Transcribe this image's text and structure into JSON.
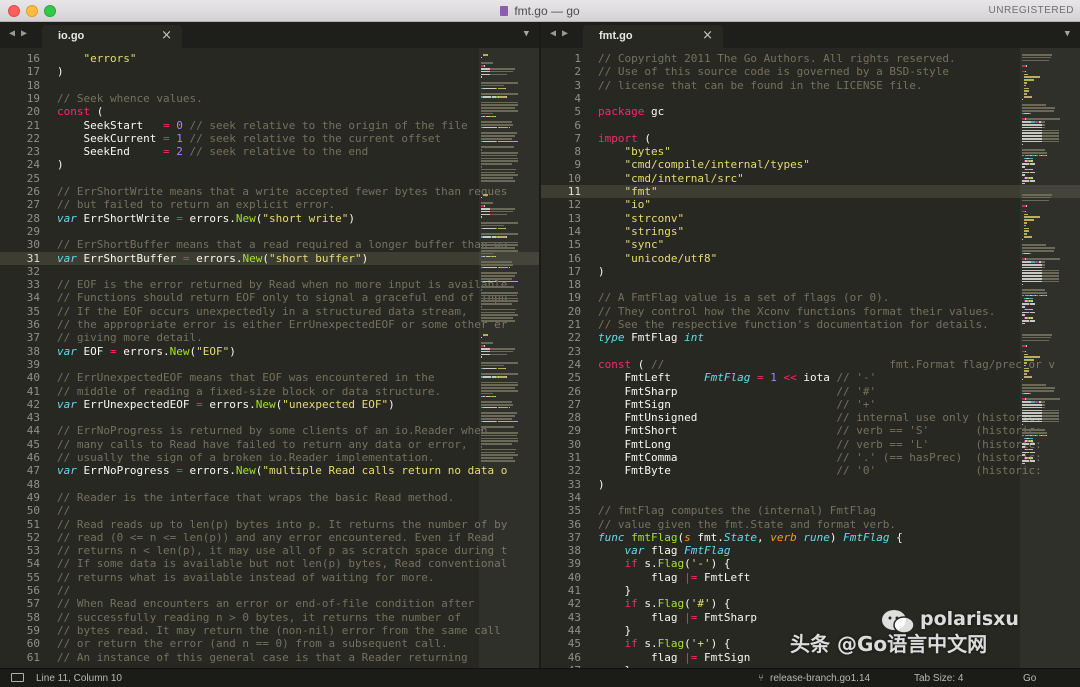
{
  "window": {
    "title": "fmt.go — go",
    "status_label": "UNREGISTERED"
  },
  "left_pane": {
    "tab_label": "io.go",
    "current_line": 31,
    "lines": [
      [
        16,
        [
          [
            "    ",
            "id"
          ],
          [
            "\"errors\"",
            "s"
          ]
        ]
      ],
      [
        17,
        [
          [
            ")",
            "id"
          ]
        ]
      ],
      [
        18,
        []
      ],
      [
        19,
        [
          [
            "// Seek whence values.",
            "c"
          ]
        ]
      ],
      [
        20,
        [
          [
            "const",
            "k"
          ],
          [
            " (",
            "id"
          ]
        ]
      ],
      [
        21,
        [
          [
            "    SeekStart   ",
            "id"
          ],
          [
            "= ",
            "k"
          ],
          [
            "0",
            "n"
          ],
          [
            " // seek relative to the origin of the file",
            "c"
          ]
        ]
      ],
      [
        22,
        [
          [
            "    SeekCurrent ",
            "id"
          ],
          [
            "= ",
            "k"
          ],
          [
            "1",
            "n"
          ],
          [
            " // seek relative to the current offset",
            "c"
          ]
        ]
      ],
      [
        23,
        [
          [
            "    SeekEnd     ",
            "id"
          ],
          [
            "= ",
            "k"
          ],
          [
            "2",
            "n"
          ],
          [
            " // seek relative to the end",
            "c"
          ]
        ]
      ],
      [
        24,
        [
          [
            ")",
            "id"
          ]
        ]
      ],
      [
        25,
        []
      ],
      [
        26,
        [
          [
            "// ErrShortWrite means that a write accepted fewer bytes than reques",
            "c"
          ]
        ]
      ],
      [
        27,
        [
          [
            "// but failed to return an explicit error.",
            "c"
          ]
        ]
      ],
      [
        28,
        [
          [
            "var",
            "kb"
          ],
          [
            " ErrShortWrite ",
            "id"
          ],
          [
            "=",
            "k"
          ],
          [
            " errors.",
            "id"
          ],
          [
            "New",
            "f"
          ],
          [
            "(",
            "id"
          ],
          [
            "\"short write\"",
            "s"
          ],
          [
            ")",
            "id"
          ]
        ]
      ],
      [
        29,
        []
      ],
      [
        30,
        [
          [
            "// ErrShortBuffer means that a read required a longer buffer than wa",
            "c"
          ]
        ]
      ],
      [
        31,
        [
          [
            "var",
            "kb"
          ],
          [
            " ErrShortBuffer ",
            "id"
          ],
          [
            "=",
            "k"
          ],
          [
            " errors.",
            "id"
          ],
          [
            "New",
            "f"
          ],
          [
            "(",
            "id"
          ],
          [
            "\"short buffer\"",
            "s"
          ],
          [
            ")",
            "id"
          ]
        ]
      ],
      [
        32,
        []
      ],
      [
        33,
        [
          [
            "// EOF is the error returned by Read when no more input is available",
            "c"
          ]
        ]
      ],
      [
        34,
        [
          [
            "// Functions should return EOF only to signal a graceful end of inpu",
            "c"
          ]
        ]
      ],
      [
        35,
        [
          [
            "// If the EOF occurs unexpectedly in a structured data stream,",
            "c"
          ]
        ]
      ],
      [
        36,
        [
          [
            "// the appropriate error is either ErrUnexpectedEOF or some other er",
            "c"
          ]
        ]
      ],
      [
        37,
        [
          [
            "// giving more detail.",
            "c"
          ]
        ]
      ],
      [
        38,
        [
          [
            "var",
            "kb"
          ],
          [
            " EOF ",
            "id"
          ],
          [
            "=",
            "k"
          ],
          [
            " errors.",
            "id"
          ],
          [
            "New",
            "f"
          ],
          [
            "(",
            "id"
          ],
          [
            "\"EOF\"",
            "s"
          ],
          [
            ")",
            "id"
          ]
        ]
      ],
      [
        39,
        []
      ],
      [
        40,
        [
          [
            "// ErrUnexpectedEOF means that EOF was encountered in the",
            "c"
          ]
        ]
      ],
      [
        41,
        [
          [
            "// middle of reading a fixed-size block or data structure.",
            "c"
          ]
        ]
      ],
      [
        42,
        [
          [
            "var",
            "kb"
          ],
          [
            " ErrUnexpectedEOF ",
            "id"
          ],
          [
            "=",
            "k"
          ],
          [
            " errors.",
            "id"
          ],
          [
            "New",
            "f"
          ],
          [
            "(",
            "id"
          ],
          [
            "\"unexpected EOF\"",
            "s"
          ],
          [
            ")",
            "id"
          ]
        ]
      ],
      [
        43,
        []
      ],
      [
        44,
        [
          [
            "// ErrNoProgress is returned by some clients of an io.Reader when",
            "c"
          ]
        ]
      ],
      [
        45,
        [
          [
            "// many calls to Read have failed to return any data or error,",
            "c"
          ]
        ]
      ],
      [
        46,
        [
          [
            "// usually the sign of a broken io.Reader implementation.",
            "c"
          ]
        ]
      ],
      [
        47,
        [
          [
            "var",
            "kb"
          ],
          [
            " ErrNoProgress ",
            "id"
          ],
          [
            "=",
            "k"
          ],
          [
            " errors.",
            "id"
          ],
          [
            "New",
            "f"
          ],
          [
            "(",
            "id"
          ],
          [
            "\"multiple Read calls return no data o",
            "s"
          ]
        ]
      ],
      [
        48,
        []
      ],
      [
        49,
        [
          [
            "// Reader is the interface that wraps the basic Read method.",
            "c"
          ]
        ]
      ],
      [
        50,
        [
          [
            "//",
            "c"
          ]
        ]
      ],
      [
        51,
        [
          [
            "// Read reads up to len(p) bytes into p. It returns the number of by",
            "c"
          ]
        ]
      ],
      [
        52,
        [
          [
            "// read (0 <= n <= len(p)) and any error encountered. Even if Read",
            "c"
          ]
        ]
      ],
      [
        53,
        [
          [
            "// returns n < len(p), it may use all of p as scratch space during t",
            "c"
          ]
        ]
      ],
      [
        54,
        [
          [
            "// If some data is available but not len(p) bytes, Read conventional",
            "c"
          ]
        ]
      ],
      [
        55,
        [
          [
            "// returns what is available instead of waiting for more.",
            "c"
          ]
        ]
      ],
      [
        56,
        [
          [
            "//",
            "c"
          ]
        ]
      ],
      [
        57,
        [
          [
            "// When Read encounters an error or end-of-file condition after",
            "c"
          ]
        ]
      ],
      [
        58,
        [
          [
            "// successfully reading n > 0 bytes, it returns the number of",
            "c"
          ]
        ]
      ],
      [
        59,
        [
          [
            "// bytes read. It may return the (non-nil) error from the same call",
            "c"
          ]
        ]
      ],
      [
        60,
        [
          [
            "// or return the error (and n == 0) from a subsequent call.",
            "c"
          ]
        ]
      ],
      [
        61,
        [
          [
            "// An instance of this general case is that a Reader returning",
            "c"
          ]
        ]
      ]
    ]
  },
  "right_pane": {
    "tab_label": "fmt.go",
    "current_line": 11,
    "lines": [
      [
        1,
        [
          [
            "// Copyright 2011 The Go Authors. All rights reserved.",
            "c"
          ]
        ]
      ],
      [
        2,
        [
          [
            "// Use of this source code is governed by a BSD-style",
            "c"
          ]
        ]
      ],
      [
        3,
        [
          [
            "// license that can be found in the LICENSE file.",
            "c"
          ]
        ]
      ],
      [
        4,
        []
      ],
      [
        5,
        [
          [
            "package",
            "k"
          ],
          [
            " gc",
            "id"
          ]
        ]
      ],
      [
        6,
        []
      ],
      [
        7,
        [
          [
            "import",
            "k"
          ],
          [
            " (",
            "id"
          ]
        ]
      ],
      [
        8,
        [
          [
            "    ",
            "id"
          ],
          [
            "\"bytes\"",
            "s"
          ]
        ]
      ],
      [
        9,
        [
          [
            "    ",
            "id"
          ],
          [
            "\"cmd/compile/internal/types\"",
            "s"
          ]
        ]
      ],
      [
        10,
        [
          [
            "    ",
            "id"
          ],
          [
            "\"cmd/internal/src\"",
            "s"
          ]
        ]
      ],
      [
        11,
        [
          [
            "    ",
            "id"
          ],
          [
            "\"fmt\"",
            "s"
          ]
        ]
      ],
      [
        12,
        [
          [
            "    ",
            "id"
          ],
          [
            "\"io\"",
            "s"
          ]
        ]
      ],
      [
        13,
        [
          [
            "    ",
            "id"
          ],
          [
            "\"strconv\"",
            "s"
          ]
        ]
      ],
      [
        14,
        [
          [
            "    ",
            "id"
          ],
          [
            "\"strings\"",
            "s"
          ]
        ]
      ],
      [
        15,
        [
          [
            "    ",
            "id"
          ],
          [
            "\"sync\"",
            "s"
          ]
        ]
      ],
      [
        16,
        [
          [
            "    ",
            "id"
          ],
          [
            "\"unicode/utf8\"",
            "s"
          ]
        ]
      ],
      [
        17,
        [
          [
            ")",
            "id"
          ]
        ]
      ],
      [
        18,
        []
      ],
      [
        19,
        [
          [
            "// A FmtFlag value is a set of flags (or 0).",
            "c"
          ]
        ]
      ],
      [
        20,
        [
          [
            "// They control how the Xconv functions format their values.",
            "c"
          ]
        ]
      ],
      [
        21,
        [
          [
            "// See the respective function's documentation for details.",
            "c"
          ]
        ]
      ],
      [
        22,
        [
          [
            "type",
            "kb"
          ],
          [
            " FmtFlag ",
            "id"
          ],
          [
            "int",
            "t"
          ]
        ]
      ],
      [
        23,
        []
      ],
      [
        24,
        [
          [
            "const",
            "k"
          ],
          [
            " ( ",
            "id"
          ],
          [
            "//                                  fmt.Format flag/prec or v",
            "c"
          ]
        ]
      ],
      [
        25,
        [
          [
            "    FmtLeft     ",
            "id"
          ],
          [
            "FmtFlag",
            "t"
          ],
          [
            " = ",
            "k"
          ],
          [
            "1",
            "n"
          ],
          [
            " << ",
            "k"
          ],
          [
            "iota",
            "id"
          ],
          [
            " // '-'",
            "c"
          ]
        ]
      ],
      [
        26,
        [
          [
            "    FmtSharp                        ",
            "id"
          ],
          [
            "// '#'",
            "c"
          ]
        ]
      ],
      [
        27,
        [
          [
            "    FmtSign                         ",
            "id"
          ],
          [
            "// '+'",
            "c"
          ]
        ]
      ],
      [
        28,
        [
          [
            "    FmtUnsigned                     ",
            "id"
          ],
          [
            "// internal use only (historic:",
            "c"
          ]
        ]
      ],
      [
        29,
        [
          [
            "    FmtShort                        ",
            "id"
          ],
          [
            "// verb == 'S'       (historic:",
            "c"
          ]
        ]
      ],
      [
        30,
        [
          [
            "    FmtLong                         ",
            "id"
          ],
          [
            "// verb == 'L'       (historic:",
            "c"
          ]
        ]
      ],
      [
        31,
        [
          [
            "    FmtComma                        ",
            "id"
          ],
          [
            "// '.' (== hasPrec)  (historic:",
            "c"
          ]
        ]
      ],
      [
        32,
        [
          [
            "    FmtByte                         ",
            "id"
          ],
          [
            "// '0'               (historic:",
            "c"
          ]
        ]
      ],
      [
        33,
        [
          [
            ")",
            "id"
          ]
        ]
      ],
      [
        34,
        []
      ],
      [
        35,
        [
          [
            "// fmtFlag computes the (internal) FmtFlag",
            "c"
          ]
        ]
      ],
      [
        36,
        [
          [
            "// value given the fmt.State and format verb.",
            "c"
          ]
        ]
      ],
      [
        37,
        [
          [
            "func",
            "kb"
          ],
          [
            " ",
            "id"
          ],
          [
            "fmtFlag",
            "f"
          ],
          [
            "(",
            "id"
          ],
          [
            "s",
            "p"
          ],
          [
            " fmt.",
            "id"
          ],
          [
            "State",
            "t"
          ],
          [
            ", ",
            "id"
          ],
          [
            "verb",
            "p"
          ],
          [
            " ",
            "id"
          ],
          [
            "rune",
            "t"
          ],
          [
            ") ",
            "id"
          ],
          [
            "FmtFlag",
            "t"
          ],
          [
            " {",
            "id"
          ]
        ]
      ],
      [
        38,
        [
          [
            "    ",
            "id"
          ],
          [
            "var",
            "kb"
          ],
          [
            " flag ",
            "id"
          ],
          [
            "FmtFlag",
            "t"
          ]
        ]
      ],
      [
        39,
        [
          [
            "    ",
            "id"
          ],
          [
            "if",
            "k"
          ],
          [
            " s.",
            "id"
          ],
          [
            "Flag",
            "f"
          ],
          [
            "(",
            "id"
          ],
          [
            "'-'",
            "s"
          ],
          [
            ") {",
            "id"
          ]
        ]
      ],
      [
        40,
        [
          [
            "        flag ",
            "id"
          ],
          [
            "|=",
            "k"
          ],
          [
            " FmtLeft",
            "id"
          ]
        ]
      ],
      [
        41,
        [
          [
            "    }",
            "id"
          ]
        ]
      ],
      [
        42,
        [
          [
            "    ",
            "id"
          ],
          [
            "if",
            "k"
          ],
          [
            " s.",
            "id"
          ],
          [
            "Flag",
            "f"
          ],
          [
            "(",
            "id"
          ],
          [
            "'#'",
            "s"
          ],
          [
            ") {",
            "id"
          ]
        ]
      ],
      [
        43,
        [
          [
            "        flag ",
            "id"
          ],
          [
            "|=",
            "k"
          ],
          [
            " FmtSharp",
            "id"
          ]
        ]
      ],
      [
        44,
        [
          [
            "    }",
            "id"
          ]
        ]
      ],
      [
        45,
        [
          [
            "    ",
            "id"
          ],
          [
            "if",
            "k"
          ],
          [
            " s.",
            "id"
          ],
          [
            "Flag",
            "f"
          ],
          [
            "(",
            "id"
          ],
          [
            "'+'",
            "s"
          ],
          [
            ") {",
            "id"
          ]
        ]
      ],
      [
        46,
        [
          [
            "        flag ",
            "id"
          ],
          [
            "|=",
            "k"
          ],
          [
            " FmtSign",
            "id"
          ]
        ]
      ],
      [
        47,
        [
          [
            "    }",
            "id"
          ]
        ]
      ]
    ]
  },
  "statusbar": {
    "position": "Line 11, Column 10",
    "branch": "release-branch.go1.14",
    "tab_size": "Tab Size: 4",
    "syntax": "Go"
  },
  "watermark": {
    "line1": "头条 @Go语言中文网",
    "line2": "polarisxu"
  },
  "icons": [
    "back-arrow-icon",
    "forward-arrow-icon",
    "close-icon",
    "tab-menu-icon",
    "panel-icon",
    "branch-icon",
    "file-icon",
    "wechat-icon"
  ]
}
